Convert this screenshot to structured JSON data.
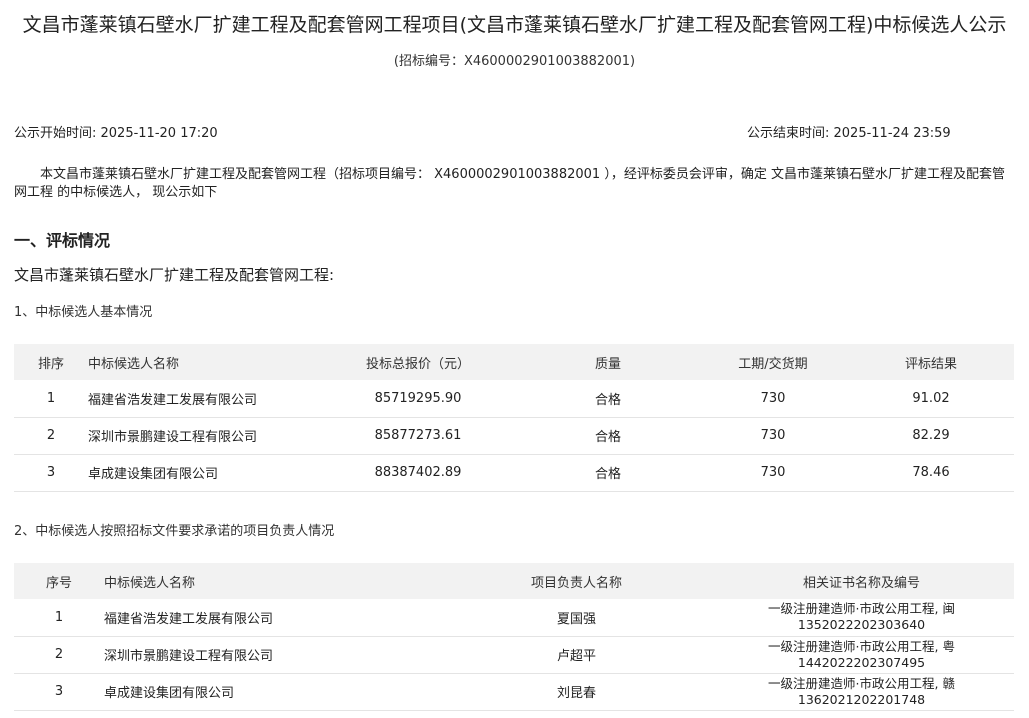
{
  "header": {
    "title": "文昌市蓬莱镇石壁水厂扩建工程及配套管网工程项目(文昌市蓬莱镇石壁水厂扩建工程及配套管网工程)中标候选人公示",
    "tender_no": "(招标编号：X4600002901003882001)"
  },
  "times": {
    "start": "公示开始时间: 2025-11-20 17:20",
    "end": "公示结束时间: 2025-11-24 23:59"
  },
  "intro": "本文昌市蓬莱镇石壁水厂扩建工程及配套管网工程（招标项目编号： X4600002901003882001 ），经评标委员会评审，确定 文昌市蓬莱镇石壁水厂扩建工程及配套管网工程 的中标候选人， 现公示如下",
  "section": {
    "heading": "一、评标情况",
    "project_name": "文昌市蓬莱镇石壁水厂扩建工程及配套管网工程:",
    "sub1": "1、中标候选人基本情况",
    "sub2": "2、中标候选人按照招标文件要求承诺的项目负责人情况"
  },
  "table1": {
    "headers": [
      "排序",
      "中标候选人名称",
      "投标总报价（元）",
      "质量",
      "工期/交货期",
      "评标结果"
    ],
    "rows": [
      [
        "1",
        "福建省浩发建工发展有限公司",
        "85719295.90",
        "合格",
        "730",
        "91.02"
      ],
      [
        "2",
        "深圳市景鹏建设工程有限公司",
        "85877273.61",
        "合格",
        "730",
        "82.29"
      ],
      [
        "3",
        "卓成建设集团有限公司",
        "88387402.89",
        "合格",
        "730",
        "78.46"
      ]
    ]
  },
  "table2": {
    "headers": [
      "序号",
      "中标候选人名称",
      "项目负责人名称",
      "相关证书名称及编号"
    ],
    "rows": [
      [
        "1",
        "福建省浩发建工发展有限公司",
        "夏国强",
        "一级注册建造师·市政公用工程, 闽",
        "1352022202303640"
      ],
      [
        "2",
        "深圳市景鹏建设工程有限公司",
        "卢超平",
        "一级注册建造师·市政公用工程, 粤",
        "1442022202307495"
      ],
      [
        "3",
        "卓成建设集团有限公司",
        "刘昆春",
        "一级注册建造师·市政公用工程, 赣",
        "1362021202201748"
      ]
    ]
  }
}
